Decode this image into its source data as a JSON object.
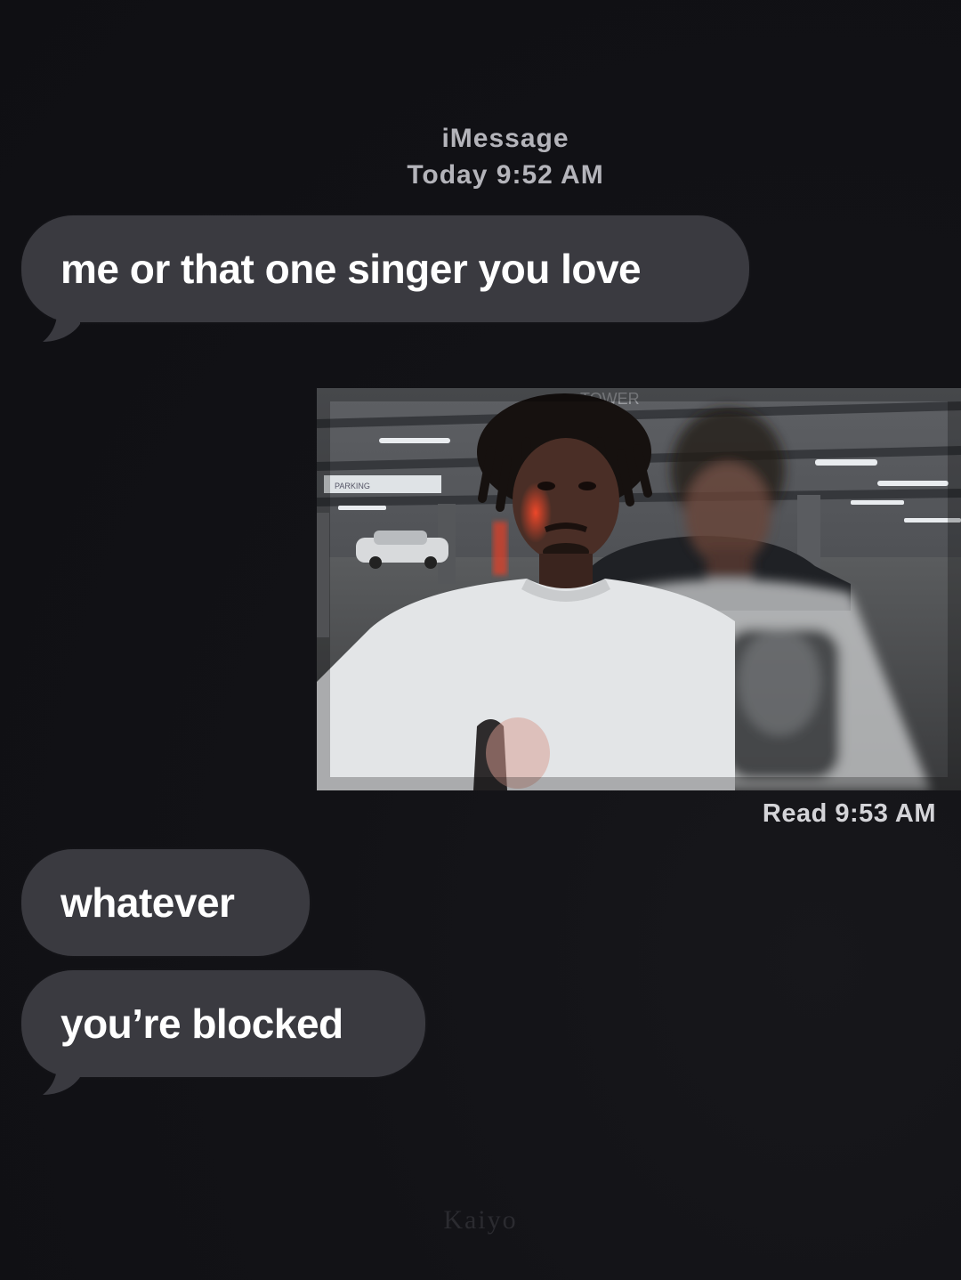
{
  "header": {
    "service": "iMessage",
    "timestamp": "Today 9:52 AM"
  },
  "messages": [
    {
      "text": "me or that one singer you love"
    },
    {
      "text": "whatever"
    },
    {
      "text": "you’re blocked"
    }
  ],
  "photo": {
    "sign_text": "TOWER",
    "parking_sign_text": "PARKING"
  },
  "read_receipt": "Read 9:53 AM",
  "watermark": "Kaiyo",
  "colors": {
    "background": "#121216",
    "received_bubble": "#3a3a40",
    "bubble_text": "#ffffff",
    "meta_text": "#b4b4ba"
  }
}
